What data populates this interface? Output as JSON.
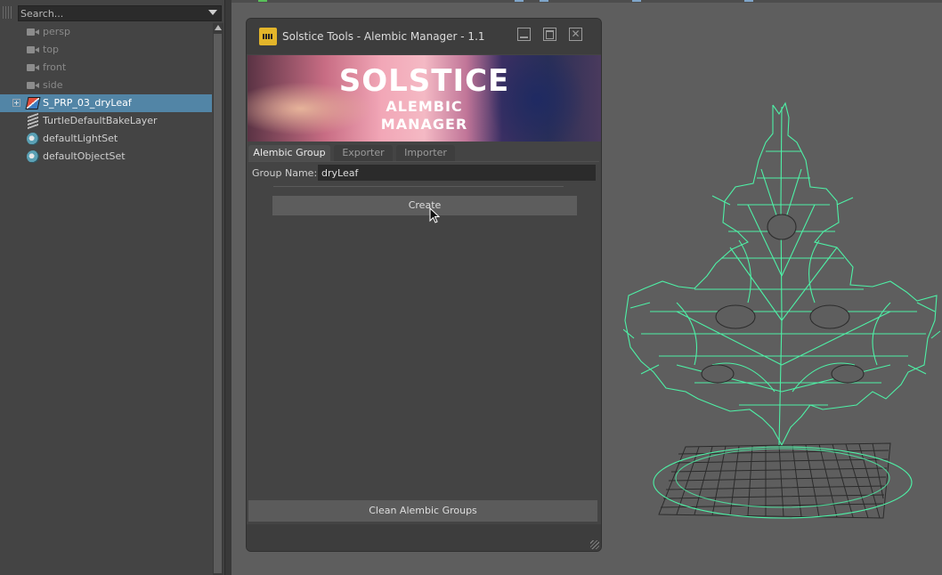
{
  "outliner": {
    "search_placeholder": "Search...",
    "items": [
      {
        "label": "persp",
        "icon": "camera-icon",
        "state": "dimmed"
      },
      {
        "label": "top",
        "icon": "camera-icon",
        "state": "dimmed"
      },
      {
        "label": "front",
        "icon": "camera-icon",
        "state": "dimmed"
      },
      {
        "label": "side",
        "icon": "camera-icon",
        "state": "dimmed"
      },
      {
        "label": "S_PRP_03_dryLeaf",
        "icon": "mesh-icon",
        "state": "selected"
      },
      {
        "label": "TurtleDefaultBakeLayer",
        "icon": "layer-icon",
        "state": "normal"
      },
      {
        "label": "defaultLightSet",
        "icon": "set-icon",
        "state": "normal"
      },
      {
        "label": "defaultObjectSet",
        "icon": "set-icon",
        "state": "normal"
      }
    ]
  },
  "window": {
    "title": "Solstice Tools - Alembic Manager - 1.1",
    "banner": {
      "logo": "SOLSTICE",
      "line1": "ALEMBIC",
      "line2": "MANAGER"
    },
    "tabs": [
      {
        "label": "Alembic Group",
        "active": true
      },
      {
        "label": "Exporter",
        "active": false
      },
      {
        "label": "Importer",
        "active": false
      }
    ],
    "group_name_label": "Group Name:",
    "group_name_value": "dryLeaf",
    "create_label": "Create",
    "clean_label": "Clean Alembic Groups",
    "close_glyph": "✕"
  },
  "colors": {
    "selection": "#5285a6",
    "wireframe": "#4ef0a6",
    "panel": "#444444",
    "viewport": "#5e5e5e"
  }
}
